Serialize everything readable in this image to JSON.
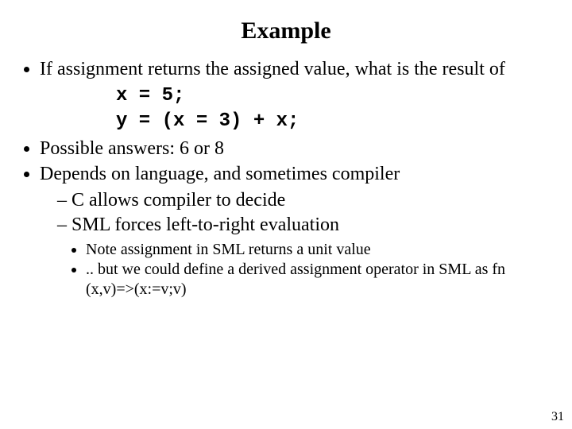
{
  "title": "Example",
  "bullets": {
    "b1": "If assignment returns the assigned value, what is the result of",
    "code1": "x = 5;",
    "code2": "y = (x = 3) + x;",
    "b2": "Possible answers: 6 or 8",
    "b3": " Depends on language, and sometimes compiler",
    "b3_1": "C allows compiler to decide",
    "b3_2": "SML forces left-to-right evaluation",
    "b3_2_1": "Note assignment in SML returns a unit value",
    "b3_2_2": ".. but we could define a derived assignment operator in SML as fn (x,v)=>(x:=v;v)"
  },
  "page_number": "31"
}
